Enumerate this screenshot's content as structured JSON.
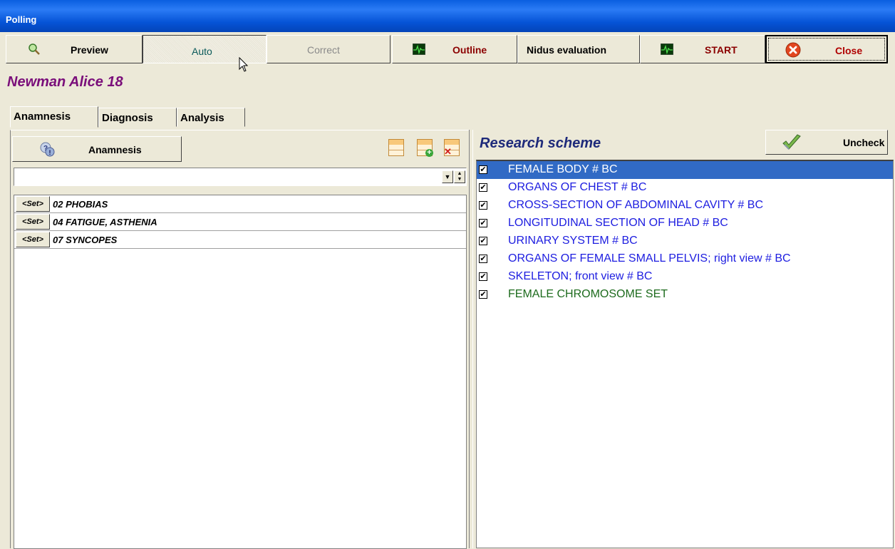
{
  "window": {
    "title": "Polling"
  },
  "toolbar": {
    "preview": "Preview",
    "auto": "Auto",
    "correct": "Correct",
    "outline": "Outline",
    "nidus": "Nidus evaluation",
    "start": "START",
    "close": "Close"
  },
  "patient": {
    "name": "Newman Alice  18"
  },
  "tabs": [
    "Anamnesis",
    "Diagnosis",
    "Analysis"
  ],
  "left": {
    "anamnesis_button": "Anamnesis",
    "combo_value": "",
    "rows": [
      {
        "set": "<Set>",
        "text": "02 PHOBIAS"
      },
      {
        "set": "<Set>",
        "text": "04 FATIGUE, ASTHENIA"
      },
      {
        "set": "<Set>",
        "text": "07 SYNCOPES"
      }
    ]
  },
  "right": {
    "title": "Research scheme",
    "uncheck": "Uncheck",
    "items": [
      {
        "text": "FEMALE BODY # BC",
        "checked": true,
        "style": "selected"
      },
      {
        "text": "ORGANS OF CHEST # BC",
        "checked": true,
        "style": "blue"
      },
      {
        "text": "CROSS-SECTION OF ABDOMINAL CAVITY # BC",
        "checked": true,
        "style": "blue"
      },
      {
        "text": "LONGITUDINAL SECTION OF HEAD # BC",
        "checked": true,
        "style": "blue"
      },
      {
        "text": "URINARY SYSTEM # BC",
        "checked": true,
        "style": "blue"
      },
      {
        "text": "ORGANS OF FEMALE SMALL PELVIS; right view # BC",
        "checked": true,
        "style": "blue"
      },
      {
        "text": "SKELETON; front view # BC",
        "checked": true,
        "style": "blue"
      },
      {
        "text": "FEMALE CHROMOSOME SET",
        "checked": true,
        "style": "green"
      }
    ]
  },
  "colors": {
    "patient": "#7A0E7A",
    "title": "#1E2A7A",
    "selected": "#316AC5",
    "item_blue": "#1D1DE0",
    "item_green": "#1D6B1D",
    "outline_red": "#8B0000"
  }
}
